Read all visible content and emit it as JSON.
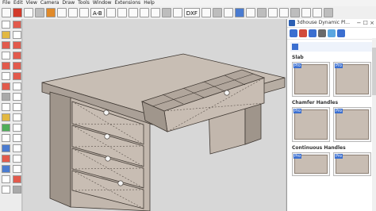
{
  "menu": [
    "File",
    "Edit",
    "View",
    "Camera",
    "Draw",
    "Tools",
    "Window",
    "Extensions",
    "Help"
  ],
  "toolbar": {
    "text_buttons": [
      "A-B",
      "DXF"
    ]
  },
  "panel": {
    "title": "3dhouse Dynamic Pl...",
    "controls": "− ☐ ×",
    "sections": [
      {
        "title": "Slab",
        "tags": [
          "Pro",
          "Pro"
        ]
      },
      {
        "title": "Chamfer Handles",
        "tags": [
          "Pro",
          "Pro"
        ]
      },
      {
        "title": "Continuous Handles",
        "tags": [
          "Pro",
          "Pro"
        ]
      }
    ]
  },
  "colors": {
    "wood_face": "#bfb4aa",
    "wood_side": "#9f958b",
    "edge": "#3f3832",
    "sky": "#d7d7d7"
  }
}
